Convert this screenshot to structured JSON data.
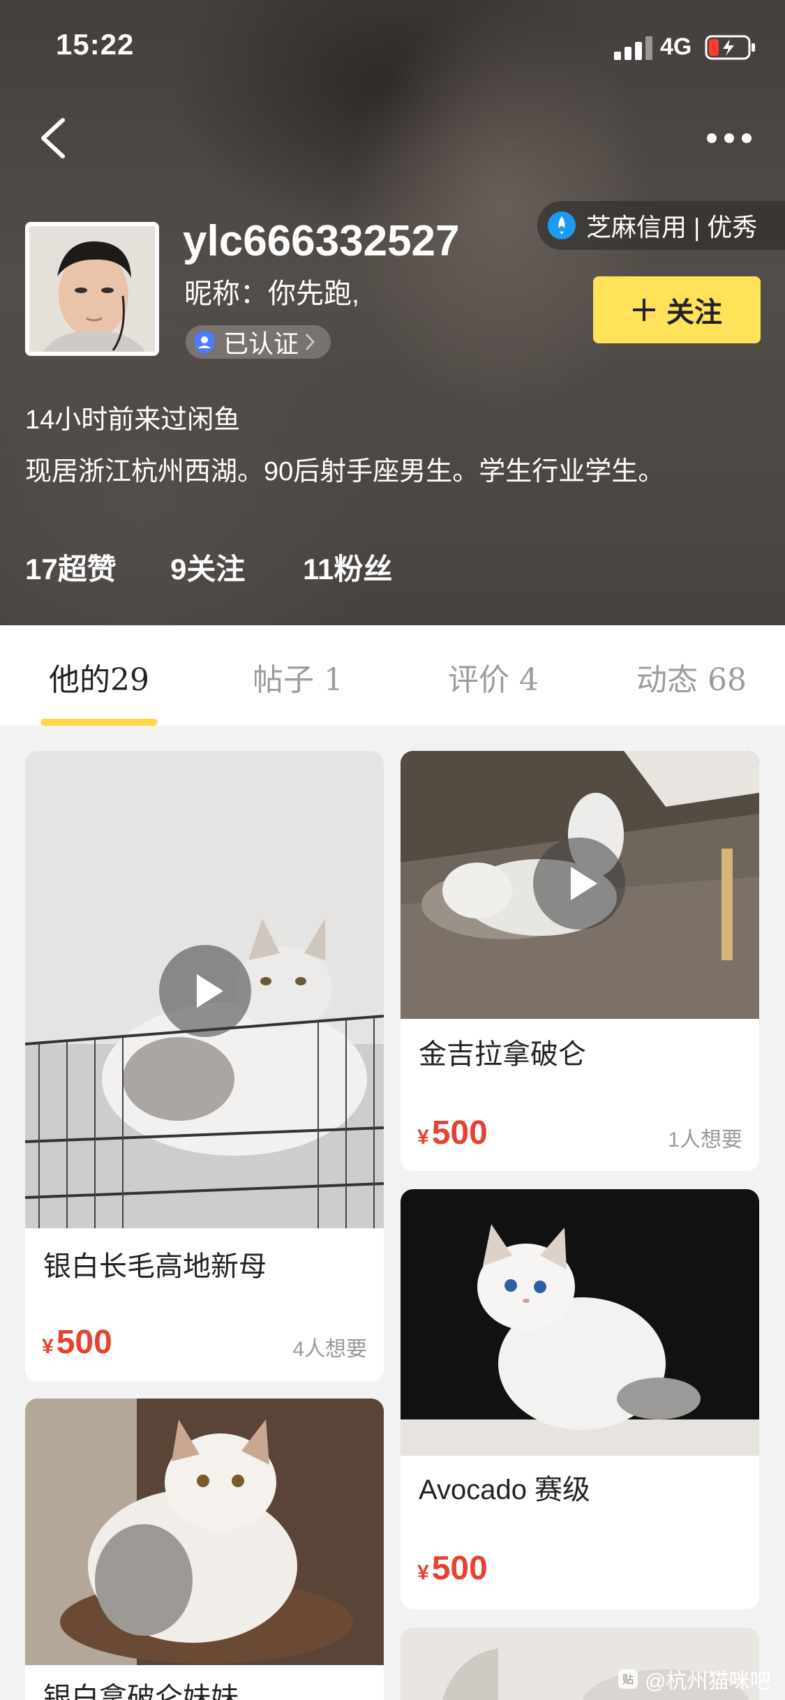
{
  "status_bar": {
    "time": "15:22",
    "network": "4G"
  },
  "profile": {
    "username": "ylc666332527",
    "nickname": "昵称：你先跑,",
    "verified_label": "已认证",
    "credit_label": "芝麻信用 | 优秀",
    "follow_label": "关注",
    "last_seen": "14小时前来过闲鱼",
    "bio": "现居浙江杭州西湖。90后射手座男生。学生行业学生。",
    "stats": [
      {
        "label": "17超赞"
      },
      {
        "label": "9关注"
      },
      {
        "label": "11粉丝"
      }
    ]
  },
  "tabs": [
    {
      "label": "他的29",
      "active": true
    },
    {
      "label": "帖子 1",
      "active": false
    },
    {
      "label": "评价 4",
      "active": false
    },
    {
      "label": "动态 68",
      "active": false
    }
  ],
  "items": [
    {
      "title": "银白长毛高地新母",
      "currency": "¥",
      "price": "500",
      "want": "4人想要",
      "video": true
    },
    {
      "title": "金吉拉拿破仑",
      "currency": "¥",
      "price": "500",
      "want": "1人想要",
      "video": true
    },
    {
      "title": "Avocado 赛级",
      "currency": "¥",
      "price": "500",
      "want": "",
      "video": false
    },
    {
      "title": "银白拿破仑妹妹",
      "currency": "¥",
      "price": "",
      "want": "",
      "video": false
    }
  ],
  "watermark": "@杭州猫咪吧",
  "colors": {
    "accent_yellow": "#ffe15a",
    "price_red": "#e8412f",
    "tab_underline": "#ffd54a"
  }
}
